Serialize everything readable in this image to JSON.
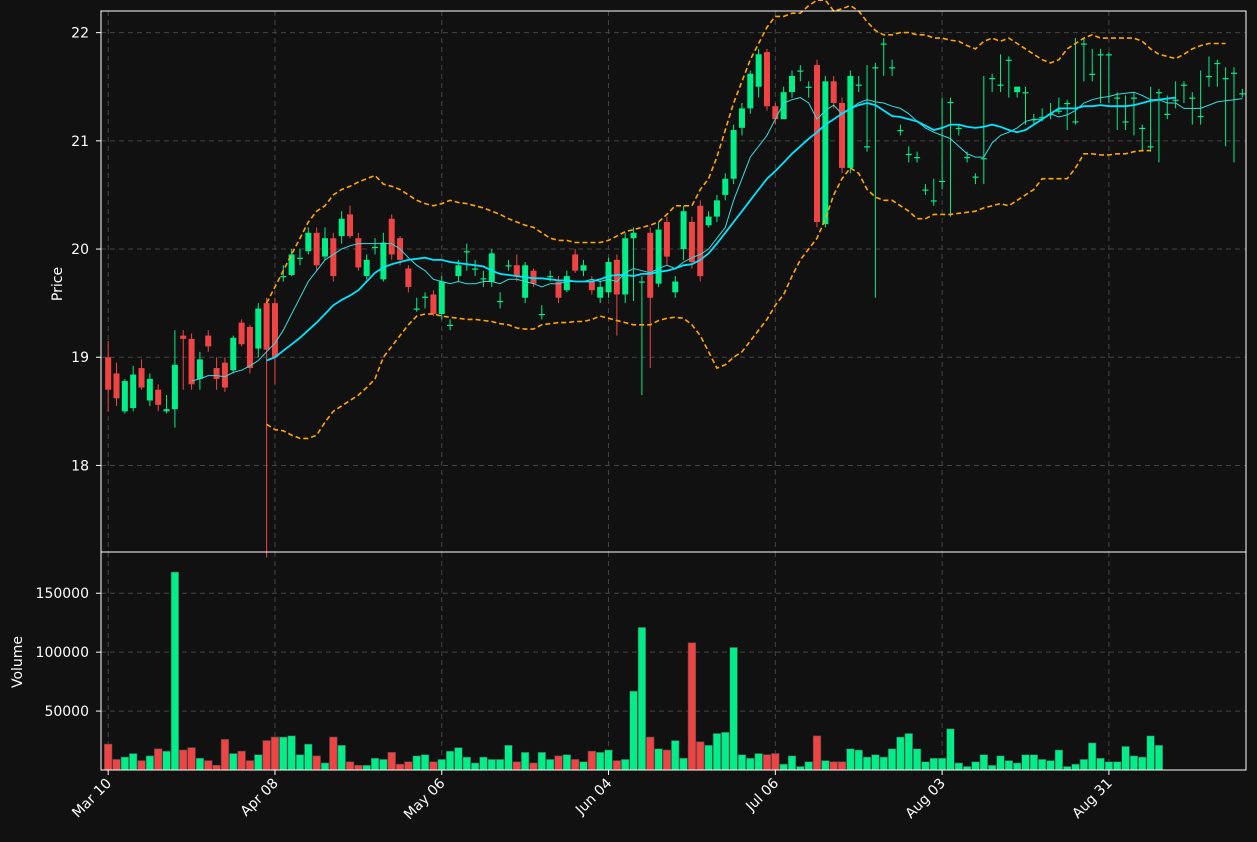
{
  "colors": {
    "background": "#111111",
    "up": "#00ee88",
    "down": "#ee4444",
    "fast_ma": "#33dddd",
    "slow_ma": "#00e5ff",
    "bands": "#ffa500",
    "grid": "#444444",
    "axis": "#ffffff"
  },
  "chart_data": [
    {
      "type": "candlestick",
      "ylabel": "Price",
      "ylim": [
        17.2,
        22.2
      ],
      "yticks": [
        18,
        19,
        20,
        21,
        22
      ],
      "xlabels": [
        "Mar 10",
        "Apr 08",
        "May 06",
        "Jun 04",
        "Jul 06",
        "Aug 03",
        "Aug 31"
      ],
      "xlabel_index": [
        0,
        20,
        40,
        60,
        80,
        100,
        120
      ],
      "grid": true,
      "overlays": [
        "moving-average-fast",
        "moving-average-slow",
        "bollinger-upper",
        "bollinger-lower"
      ],
      "close": [
        18.7,
        18.62,
        18.78,
        18.84,
        18.72,
        18.8,
        18.56,
        18.52,
        18.93,
        19.17,
        18.75,
        18.98,
        19.1,
        18.8,
        18.72,
        19.18,
        19.12,
        18.9,
        19.45,
        19.07,
        19.0,
        19.75,
        19.95,
        19.92,
        20.15,
        19.85,
        20.1,
        19.75,
        20.28,
        20.12,
        19.83,
        19.9,
        20.02,
        20.06,
        19.95,
        19.9,
        19.65,
        19.45,
        19.56,
        19.4,
        19.7,
        19.3,
        19.85,
        19.98,
        19.82,
        19.73,
        19.96,
        19.52,
        19.85,
        19.75,
        19.85,
        19.68,
        19.4,
        19.75,
        19.55,
        19.75,
        19.8,
        19.85,
        19.62,
        19.65,
        19.88,
        19.58,
        20.1,
        20.15,
        19.7,
        19.55,
        20.18,
        19.93,
        19.7,
        20.35,
        19.88,
        19.75,
        20.3,
        20.45,
        20.65,
        21.1,
        21.3,
        21.62,
        21.8,
        21.32,
        21.2,
        21.45,
        21.6,
        21.65,
        21.5,
        20.25,
        21.55,
        21.35,
        20.75,
        21.6,
        21.52,
        20.95,
        21.68,
        21.9,
        21.68,
        21.1,
        20.88,
        20.85,
        20.55,
        20.45,
        20.63,
        21.36,
        21.12,
        20.85,
        20.67,
        20.84,
        21.58,
        21.52,
        21.75,
        21.5,
        21.45,
        21.2,
        21.22,
        21.25,
        21.28,
        21.35,
        21.18,
        21.9,
        21.62,
        21.8,
        21.8,
        21.4,
        21.18,
        21.4,
        21.12,
        20.95,
        21.45,
        21.25,
        21.38,
        21.52,
        21.4,
        21.23,
        21.6,
        21.72,
        21.58,
        21.63,
        21.44
      ],
      "open": [
        19.0,
        18.85,
        18.5,
        18.53,
        18.9,
        18.6,
        18.7,
        18.5,
        18.52,
        19.2,
        19.17,
        18.8,
        19.2,
        18.9,
        18.95,
        18.88,
        19.32,
        19.28,
        19.08,
        19.5,
        19.5,
        19.75,
        19.76,
        19.92,
        19.98,
        20.15,
        19.93,
        20.1,
        20.12,
        20.32,
        20.1,
        19.75,
        20.02,
        19.72,
        20.28,
        20.1,
        19.82,
        19.45,
        19.55,
        19.58,
        19.4,
        19.3,
        19.75,
        19.98,
        19.82,
        19.73,
        19.7,
        19.52,
        19.85,
        19.85,
        19.55,
        19.8,
        19.4,
        19.75,
        19.7,
        19.62,
        19.95,
        19.8,
        19.7,
        19.55,
        19.6,
        19.9,
        19.58,
        20.1,
        19.7,
        20.15,
        19.68,
        20.25,
        19.6,
        20.0,
        20.25,
        20.4,
        20.22,
        20.3,
        20.5,
        20.65,
        21.12,
        21.3,
        21.5,
        21.82,
        21.32,
        21.2,
        21.45,
        21.65,
        21.5,
        21.7,
        20.23,
        21.55,
        21.35,
        20.75,
        21.52,
        20.95,
        21.68,
        21.9,
        21.68,
        21.1,
        20.88,
        20.85,
        20.55,
        20.45,
        20.63,
        21.36,
        21.12,
        20.85,
        20.67,
        20.84,
        21.58,
        21.52,
        21.75,
        21.45,
        21.45,
        21.2,
        21.22,
        21.25,
        21.28,
        21.35,
        21.18,
        21.9,
        21.62,
        21.8,
        21.8,
        21.4,
        21.18,
        21.4,
        21.12,
        20.95,
        21.45,
        21.25,
        21.38,
        21.52,
        21.4,
        21.23,
        21.6,
        21.72,
        21.58,
        21.63,
        21.44
      ],
      "high": [
        19.15,
        18.95,
        18.8,
        18.92,
        18.98,
        18.85,
        18.75,
        18.65,
        19.25,
        19.25,
        19.22,
        19.05,
        19.25,
        19.0,
        19.0,
        19.2,
        19.35,
        19.3,
        19.5,
        19.55,
        19.55,
        19.85,
        20.0,
        20.0,
        20.2,
        20.2,
        20.2,
        20.15,
        20.35,
        20.4,
        20.15,
        19.95,
        20.1,
        20.15,
        20.32,
        20.12,
        19.85,
        19.55,
        19.6,
        19.62,
        19.75,
        19.35,
        19.9,
        20.05,
        19.9,
        19.8,
        20.0,
        19.6,
        19.9,
        19.95,
        19.88,
        19.82,
        19.48,
        19.8,
        19.75,
        19.8,
        20.0,
        19.9,
        19.75,
        19.7,
        19.92,
        19.95,
        20.15,
        20.2,
        19.75,
        20.2,
        20.25,
        20.3,
        19.75,
        20.4,
        20.3,
        20.45,
        20.35,
        20.5,
        20.7,
        21.15,
        21.35,
        21.65,
        21.85,
        21.85,
        21.35,
        21.5,
        21.65,
        21.7,
        21.55,
        21.75,
        21.6,
        21.6,
        21.4,
        21.65,
        21.6,
        21.7,
        21.72,
        21.95,
        21.75,
        21.15,
        20.95,
        20.9,
        20.6,
        20.65,
        21.4,
        21.4,
        21.15,
        20.9,
        20.7,
        21.6,
        21.62,
        21.8,
        21.78,
        21.5,
        21.5,
        21.25,
        21.3,
        21.35,
        21.4,
        21.38,
        21.95,
        21.95,
        21.85,
        21.85,
        21.82,
        21.45,
        21.42,
        21.45,
        21.15,
        21.5,
        21.48,
        21.42,
        21.55,
        21.55,
        21.45,
        21.65,
        21.78,
        21.75,
        21.68,
        21.68,
        21.48
      ],
      "low": [
        18.5,
        18.55,
        18.48,
        18.5,
        18.7,
        18.55,
        18.5,
        18.48,
        18.35,
        18.7,
        18.7,
        18.7,
        19.05,
        18.7,
        18.68,
        18.85,
        19.1,
        18.85,
        19.0,
        17.15,
        18.75,
        19.7,
        19.75,
        19.85,
        19.95,
        19.8,
        19.9,
        19.7,
        20.05,
        20.1,
        19.8,
        19.72,
        19.95,
        19.7,
        19.9,
        19.85,
        19.6,
        19.42,
        19.45,
        19.38,
        19.35,
        19.25,
        19.7,
        19.8,
        19.75,
        19.65,
        19.65,
        19.45,
        19.8,
        19.7,
        19.5,
        19.65,
        19.35,
        19.7,
        19.5,
        19.6,
        19.78,
        19.75,
        19.58,
        19.5,
        19.55,
        19.2,
        19.5,
        19.52,
        18.65,
        18.9,
        19.65,
        19.85,
        19.55,
        19.9,
        19.82,
        19.7,
        20.2,
        20.25,
        20.45,
        20.6,
        21.05,
        21.25,
        21.4,
        21.28,
        21.15,
        21.4,
        21.4,
        21.55,
        21.4,
        20.2,
        20.2,
        21.3,
        20.7,
        20.7,
        21.45,
        20.9,
        19.55,
        21.6,
        21.6,
        21.05,
        20.8,
        20.8,
        20.5,
        20.4,
        20.55,
        20.3,
        21.05,
        20.8,
        20.6,
        20.6,
        21.45,
        21.45,
        21.4,
        21.4,
        21.15,
        21.15,
        21.18,
        21.2,
        21.25,
        21.1,
        21.15,
        21.55,
        21.55,
        21.35,
        21.35,
        21.1,
        21.1,
        21.05,
        20.9,
        20.9,
        20.8,
        21.2,
        21.3,
        21.35,
        21.15,
        21.15,
        21.5,
        21.5,
        20.95,
        20.8,
        21.4
      ],
      "ma_fast": [
        null,
        null,
        null,
        null,
        null,
        null,
        null,
        null,
        null,
        null,
        18.78,
        18.8,
        18.83,
        18.83,
        18.82,
        18.86,
        18.88,
        18.92,
        18.97,
        19.05,
        19.13,
        19.25,
        19.4,
        19.55,
        19.7,
        19.8,
        19.9,
        19.95,
        20.0,
        20.03,
        20.05,
        20.05,
        20.05,
        20.05,
        20.05,
        20.0,
        19.92,
        19.85,
        19.8,
        19.72,
        19.7,
        19.68,
        19.7,
        19.68,
        19.68,
        19.7,
        19.7,
        19.68,
        19.72,
        19.72,
        19.7,
        19.68,
        19.65,
        19.68,
        19.68,
        19.7,
        19.7,
        19.7,
        19.72,
        19.7,
        19.72,
        19.7,
        19.78,
        19.82,
        19.8,
        19.78,
        19.82,
        19.85,
        19.82,
        19.88,
        19.92,
        19.95,
        20.0,
        20.1,
        20.2,
        20.45,
        20.65,
        20.85,
        20.95,
        21.05,
        21.2,
        21.35,
        21.38,
        21.4,
        21.35,
        21.2,
        21.28,
        21.33,
        21.25,
        21.3,
        21.35,
        21.38,
        21.36,
        21.35,
        21.32,
        21.3,
        21.25,
        21.18,
        21.12,
        21.08,
        21.05,
        21.02,
        20.95,
        20.88,
        20.85,
        20.85,
        20.98,
        21.05,
        21.08,
        21.12,
        21.18,
        21.2,
        21.2,
        21.25,
        21.22,
        21.24,
        21.28,
        21.35,
        21.38,
        21.4,
        21.41,
        21.43,
        21.44,
        21.45,
        21.42,
        21.38,
        21.38,
        21.35,
        21.35,
        21.3,
        21.3,
        21.3,
        21.33,
        21.36,
        21.37,
        21.38,
        21.39
      ],
      "ma_slow": [
        null,
        null,
        null,
        null,
        null,
        null,
        null,
        null,
        null,
        null,
        null,
        null,
        null,
        null,
        null,
        null,
        null,
        null,
        null,
        18.97,
        19.0,
        19.06,
        19.12,
        19.18,
        19.25,
        19.32,
        19.4,
        19.48,
        19.53,
        19.57,
        19.62,
        19.7,
        19.78,
        19.83,
        19.86,
        19.88,
        19.9,
        19.91,
        19.92,
        19.9,
        19.9,
        19.88,
        19.87,
        19.86,
        19.85,
        19.84,
        19.8,
        19.77,
        19.76,
        19.75,
        19.74,
        19.73,
        19.73,
        19.72,
        19.71,
        19.71,
        19.7,
        19.7,
        19.7,
        19.72,
        19.75,
        19.76,
        19.76,
        19.75,
        19.77,
        19.77,
        19.79,
        19.8,
        19.82,
        19.85,
        19.86,
        19.9,
        19.96,
        20.05,
        20.15,
        20.25,
        20.35,
        20.45,
        20.55,
        20.65,
        20.72,
        20.8,
        20.88,
        20.95,
        21.02,
        21.08,
        21.15,
        21.2,
        21.25,
        21.3,
        21.33,
        21.35,
        21.33,
        21.28,
        21.23,
        21.22,
        21.2,
        21.18,
        21.14,
        21.1,
        21.12,
        21.15,
        21.15,
        21.13,
        21.12,
        21.13,
        21.15,
        21.13,
        21.1,
        21.08,
        21.1,
        21.15,
        21.2,
        21.25,
        21.3,
        21.3,
        21.3,
        21.32,
        21.32,
        21.33,
        21.32,
        21.32,
        21.32,
        21.33,
        21.35,
        21.37,
        21.38,
        21.39,
        21.4
      ],
      "bb_upper": [
        null,
        null,
        null,
        null,
        null,
        null,
        null,
        null,
        null,
        null,
        null,
        null,
        null,
        null,
        null,
        null,
        null,
        null,
        null,
        19.5,
        19.65,
        19.8,
        19.95,
        20.1,
        20.25,
        20.35,
        20.4,
        20.5,
        20.55,
        20.58,
        20.62,
        20.65,
        20.68,
        20.6,
        20.58,
        20.55,
        20.5,
        20.45,
        20.42,
        20.4,
        20.42,
        20.45,
        20.43,
        20.42,
        20.4,
        20.38,
        20.35,
        20.32,
        20.28,
        20.25,
        20.22,
        20.2,
        20.15,
        20.1,
        20.08,
        20.08,
        20.06,
        20.06,
        20.06,
        20.06,
        20.08,
        20.12,
        20.16,
        20.18,
        20.2,
        20.22,
        20.25,
        20.32,
        20.4,
        20.4,
        20.4,
        20.55,
        20.65,
        20.85,
        21.1,
        21.35,
        21.55,
        21.75,
        21.9,
        22.05,
        22.15,
        22.15,
        22.18,
        22.18,
        22.25,
        22.3,
        22.3,
        22.2,
        22.22,
        22.25,
        22.2,
        22.1,
        22.02,
        21.98,
        21.98,
        22.0,
        22.0,
        21.98,
        21.98,
        21.95,
        21.95,
        21.93,
        21.92,
        21.88,
        21.85,
        21.92,
        21.95,
        21.92,
        21.95,
        21.9,
        21.85,
        21.8,
        21.75,
        21.72,
        21.75,
        21.85,
        21.9,
        21.95,
        21.98,
        21.95,
        21.95,
        21.95,
        21.95,
        21.95,
        21.92,
        21.85,
        21.8,
        21.78,
        21.76,
        21.8,
        21.85,
        21.88,
        21.9,
        21.9,
        21.9
      ],
      "bb_lower": [
        null,
        null,
        null,
        null,
        null,
        null,
        null,
        null,
        null,
        null,
        null,
        null,
        null,
        null,
        null,
        null,
        null,
        null,
        null,
        18.38,
        18.33,
        18.32,
        18.28,
        18.25,
        18.25,
        18.28,
        18.4,
        18.5,
        18.55,
        18.6,
        18.65,
        18.72,
        18.8,
        19.0,
        19.1,
        19.2,
        19.3,
        19.38,
        19.4,
        19.4,
        19.38,
        19.37,
        19.36,
        19.35,
        19.35,
        19.34,
        19.33,
        19.31,
        19.3,
        19.27,
        19.26,
        19.26,
        19.3,
        19.31,
        19.32,
        19.32,
        19.33,
        19.33,
        19.35,
        19.38,
        19.36,
        19.34,
        19.32,
        19.3,
        19.3,
        19.3,
        19.34,
        19.36,
        19.37,
        19.36,
        19.3,
        19.2,
        19.05,
        18.9,
        18.93,
        19.0,
        19.05,
        19.15,
        19.25,
        19.35,
        19.48,
        19.58,
        19.75,
        19.9,
        20.0,
        20.1,
        20.28,
        20.5,
        20.65,
        20.75,
        20.7,
        20.55,
        20.48,
        20.45,
        20.45,
        20.4,
        20.35,
        20.28,
        20.28,
        20.32,
        20.32,
        20.32,
        20.33,
        20.34,
        20.35,
        20.38,
        20.4,
        20.42,
        20.4,
        20.45,
        20.5,
        20.55,
        20.65,
        20.65,
        20.65,
        20.65,
        20.75,
        20.88,
        20.88,
        20.87,
        20.87,
        20.88,
        20.88,
        20.9,
        20.91,
        20.91
      ]
    },
    {
      "type": "bar",
      "ylabel": "Volume",
      "ylim": [
        0,
        185000
      ],
      "yticks": [
        50000,
        100000,
        150000
      ],
      "grid": true,
      "values": [
        22000,
        9000,
        11000,
        14000,
        8000,
        12000,
        18000,
        16000,
        168000,
        17000,
        19000,
        10000,
        8000,
        4000,
        26000,
        14000,
        16000,
        8000,
        13000,
        25000,
        28000,
        28000,
        29000,
        13000,
        22000,
        12000,
        6000,
        28000,
        21000,
        7000,
        4000,
        4000,
        10000,
        9000,
        15000,
        5000,
        7000,
        12000,
        13000,
        7000,
        9000,
        16000,
        19000,
        11000,
        6000,
        11000,
        9000,
        9000,
        21000,
        7000,
        15000,
        6000,
        15000,
        9000,
        12000,
        13000,
        9000,
        7000,
        16000,
        15000,
        17000,
        8000,
        9000,
        67000,
        121000,
        28000,
        18000,
        17000,
        25000,
        10000,
        108000,
        24000,
        21000,
        31000,
        32000,
        104000,
        13000,
        10000,
        14000,
        13000,
        14000,
        5000,
        12000,
        3000,
        7000,
        29000,
        8000,
        7000,
        7000,
        18000,
        17000,
        11000,
        13000,
        11000,
        18000,
        28000,
        31000,
        18000,
        7000,
        10000,
        10000,
        35000,
        6000,
        3000,
        7000,
        13000,
        4000,
        12000,
        8000,
        6000,
        13000,
        13000,
        9000,
        8000,
        17000,
        3000,
        5000,
        9000,
        23000,
        10000,
        7000,
        7000,
        20000,
        12000,
        11000,
        29000,
        21000
      ]
    }
  ]
}
